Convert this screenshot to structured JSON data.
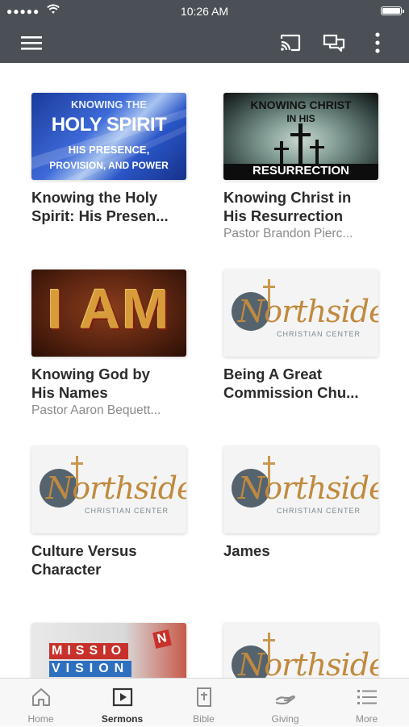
{
  "status_bar": {
    "signal": "●●●●●",
    "time": "10:26 AM"
  },
  "icons": {
    "menu": "menu-icon",
    "cast": "cast-icon",
    "chat": "chat-icon",
    "more_vert": "more-vertical-icon"
  },
  "colors": {
    "header": "#4a5055",
    "tab_active": "#333333",
    "tab_inactive": "#8c8c8c",
    "logo_gold": "#c08a3e"
  },
  "sermons": [
    {
      "title": "Knowing the Holy\nSpirit: His Presen...",
      "subtitle": "",
      "art": {
        "line1": "KNOWING THE",
        "line2": "HOLY SPIRIT",
        "line3": "HIS PRESENCE,",
        "line4": "PROVISION, AND POWER"
      }
    },
    {
      "title": "Knowing Christ in\nHis Resurrection",
      "subtitle": "Pastor Brandon Pierc...",
      "art": {
        "line1": "KNOWING CHRIST",
        "line2": "IN HIS",
        "line3": "RESURRECTION"
      }
    },
    {
      "title": "Knowing God by\nHis Names",
      "subtitle": "Pastor Aaron Bequett...",
      "art": {
        "word": "I AM"
      }
    },
    {
      "title": "Being A Great\nCommission Chu...",
      "subtitle": "",
      "art": {
        "logo": "Northside",
        "logo_sub": "CHRISTIAN CENTER"
      }
    },
    {
      "title": "Culture Versus\nCharacter",
      "subtitle": "",
      "art": {
        "logo": "Northside",
        "logo_sub": "CHRISTIAN CENTER"
      }
    },
    {
      "title": "James",
      "subtitle": "",
      "art": {
        "logo": "Northside",
        "logo_sub": "CHRISTIAN CENTER"
      }
    },
    {
      "title": "",
      "subtitle": "",
      "art": {
        "word1": "MISSIO",
        "extra": "N",
        "word2": "VISION"
      }
    },
    {
      "title": "",
      "subtitle": "",
      "art": {
        "logo": "Northside"
      }
    }
  ],
  "tabs": [
    {
      "label": "Home",
      "icon": "home-icon"
    },
    {
      "label": "Sermons",
      "icon": "play-icon",
      "active": true
    },
    {
      "label": "Bible",
      "icon": "bible-icon"
    },
    {
      "label": "Giving",
      "icon": "giving-icon"
    },
    {
      "label": "More",
      "icon": "list-icon"
    }
  ]
}
